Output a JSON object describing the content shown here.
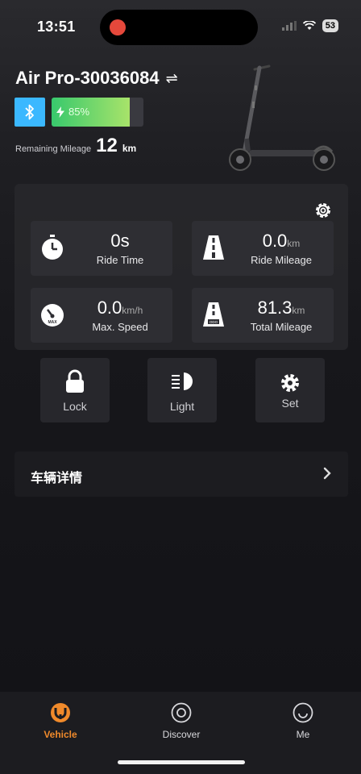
{
  "status_bar": {
    "time": "13:51",
    "battery": "53"
  },
  "device": {
    "name": "Air Pro-30036084",
    "battery_percent": "85%",
    "battery_level": 0.85,
    "remaining_label": "Remaining Mileage",
    "remaining_value": "12",
    "remaining_unit": "km"
  },
  "stats": [
    {
      "value": "0s",
      "unit": "",
      "label": "Ride Time"
    },
    {
      "value": "0.0",
      "unit": "km",
      "label": "Ride Mileage"
    },
    {
      "value": "0.0",
      "unit": "km/h",
      "label": "Max. Speed"
    },
    {
      "value": "81.3",
      "unit": "km",
      "label": "Total Mileage"
    }
  ],
  "controls": {
    "lock": "Lock",
    "light": "Light",
    "set": "Set"
  },
  "detail": {
    "label": "车辆详情"
  },
  "tabs": [
    {
      "label": "Vehicle",
      "icon": "vehicle-icon"
    },
    {
      "label": "Discover",
      "icon": "discover-icon"
    },
    {
      "label": "Me",
      "icon": "me-icon"
    }
  ],
  "colors": {
    "accent": "#f08a2b",
    "bluetooth": "#3bb8ff",
    "battery_start": "#38c96d",
    "battery_end": "#a8e36a"
  }
}
